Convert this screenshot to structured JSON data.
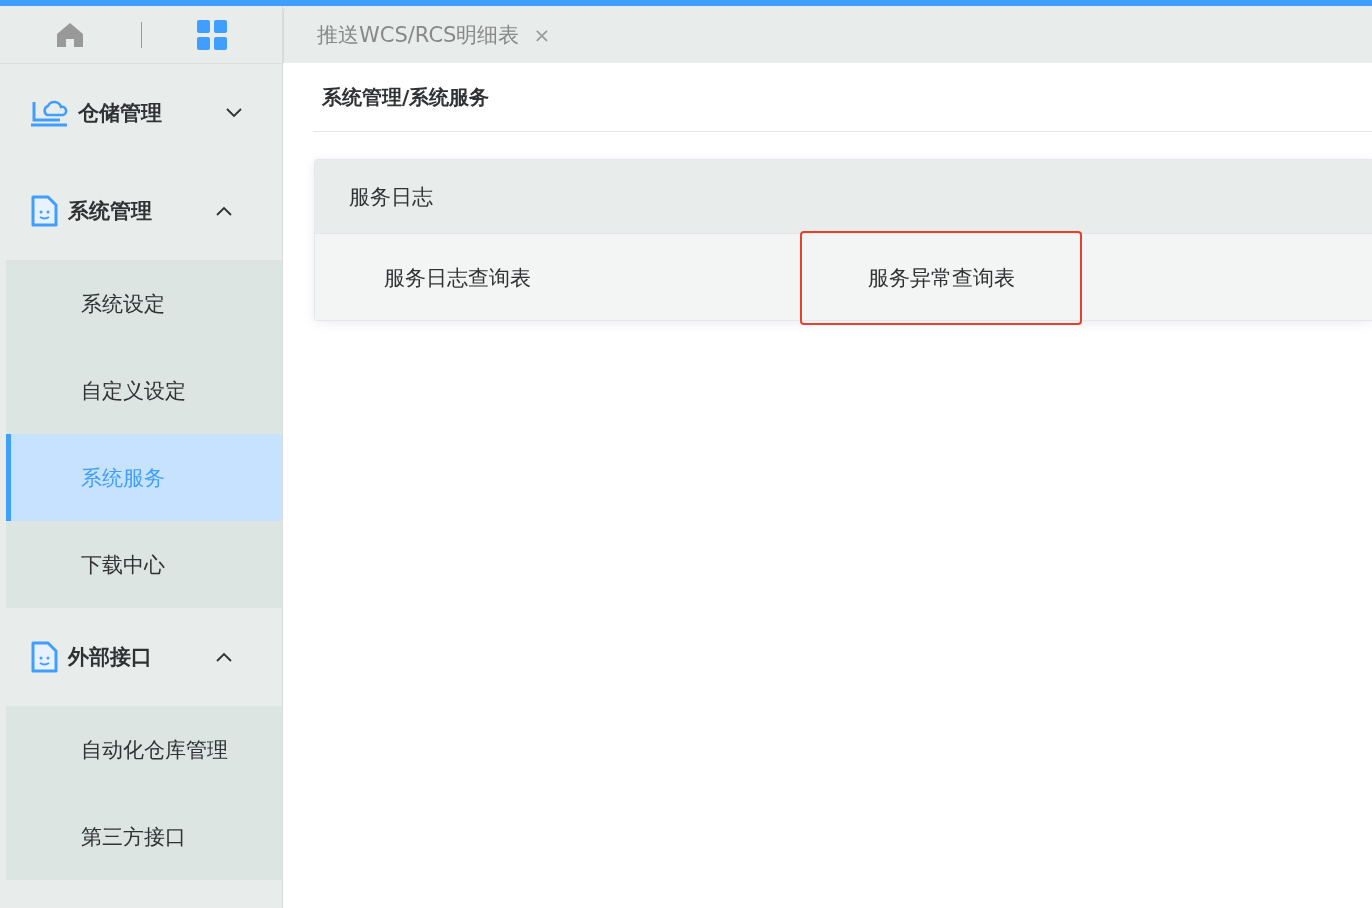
{
  "tabs": [
    {
      "label": "推送WCS/RCS明细表",
      "close": "×",
      "selected": true
    }
  ],
  "sidebar": {
    "groups": [
      {
        "label": "仓储管理",
        "expanded": false
      },
      {
        "label": "系统管理",
        "expanded": true,
        "items": [
          {
            "label": "系统设定",
            "selected": false
          },
          {
            "label": "自定义设定",
            "selected": false
          },
          {
            "label": "系统服务",
            "selected": true
          },
          {
            "label": "下载中心",
            "selected": false
          }
        ]
      },
      {
        "label": "外部接口",
        "expanded": true,
        "items": [
          {
            "label": "自动化仓库管理",
            "selected": false
          },
          {
            "label": "第三方接口",
            "selected": false
          }
        ]
      }
    ]
  },
  "breadcrumb": "系统管理/系统服务",
  "card": {
    "title": "服务日志",
    "links": [
      {
        "label": "服务日志查询表",
        "highlighted": false
      },
      {
        "label": "服务异常查询表",
        "highlighted": true
      }
    ]
  }
}
